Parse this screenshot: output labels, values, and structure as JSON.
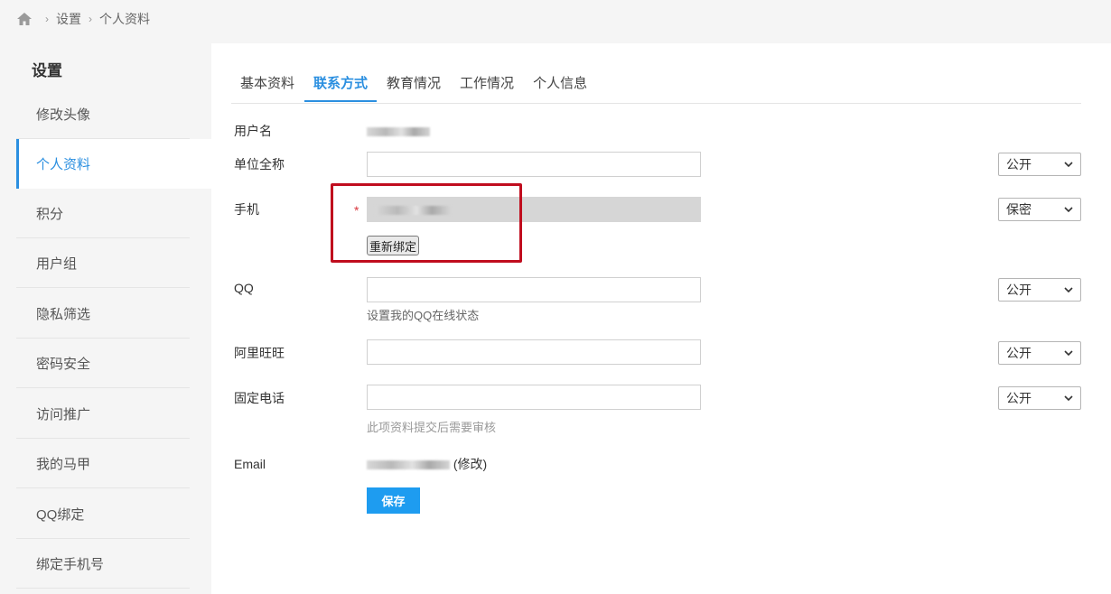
{
  "breadcrumb": {
    "items": [
      "设置",
      "个人资料"
    ]
  },
  "sidebar": {
    "title": "设置",
    "items": [
      {
        "label": "修改头像",
        "active": false
      },
      {
        "label": "个人资料",
        "active": true
      },
      {
        "label": "积分",
        "active": false
      },
      {
        "label": "用户组",
        "active": false
      },
      {
        "label": "隐私筛选",
        "active": false
      },
      {
        "label": "密码安全",
        "active": false
      },
      {
        "label": "访问推广",
        "active": false
      },
      {
        "label": "我的马甲",
        "active": false
      },
      {
        "label": "QQ绑定",
        "active": false
      },
      {
        "label": "绑定手机号",
        "active": false
      }
    ]
  },
  "tabs": [
    {
      "label": "基本资料",
      "active": false
    },
    {
      "label": "联系方式",
      "active": true
    },
    {
      "label": "教育情况",
      "active": false
    },
    {
      "label": "工作情况",
      "active": false
    },
    {
      "label": "个人信息",
      "active": false
    }
  ],
  "form": {
    "username": {
      "label": "用户名"
    },
    "company": {
      "label": "单位全称",
      "value": "",
      "privacy": "公开"
    },
    "mobile": {
      "label": "手机",
      "required_mark": "*",
      "privacy": "保密",
      "rebind_label": "重新绑定"
    },
    "qq": {
      "label": "QQ",
      "value": "",
      "privacy": "公开",
      "hint": "设置我的QQ在线状态"
    },
    "aliwangwang": {
      "label": "阿里旺旺",
      "value": "",
      "privacy": "公开"
    },
    "landline": {
      "label": "固定电话",
      "value": "",
      "privacy": "公开",
      "hint": "此项资料提交后需要审核"
    },
    "email": {
      "label": "Email",
      "edit_label": "(修改)"
    },
    "save_label": "保存"
  },
  "colors": {
    "accent": "#2b8fe0",
    "highlight_box": "#c00d1e",
    "save_button": "#1e9cf0"
  }
}
